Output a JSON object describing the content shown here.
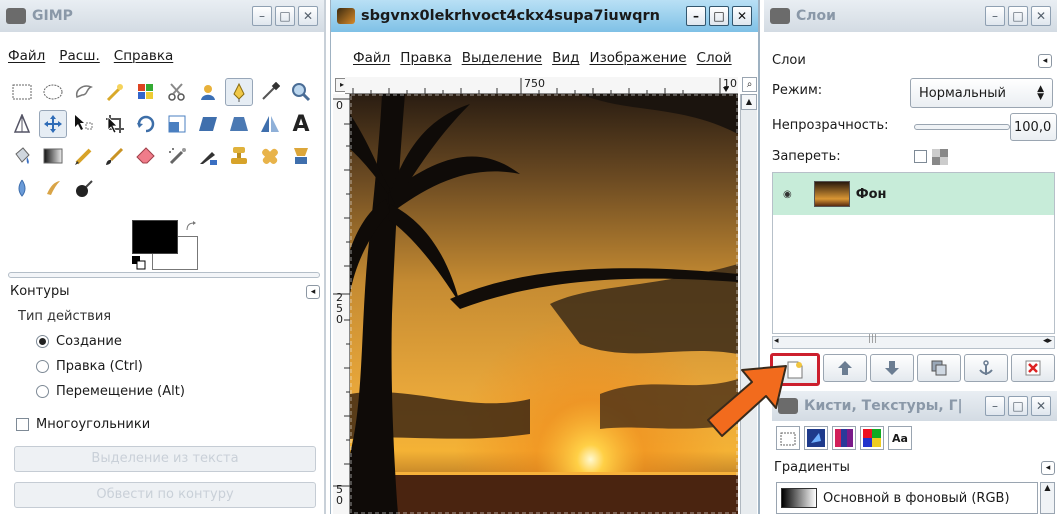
{
  "toolbox": {
    "title": "GIMP",
    "menu": [
      "Файл",
      "Расш.",
      "Справка"
    ],
    "tool_icons": [
      "rect-select-icon",
      "ellipse-select-icon",
      "free-select-icon",
      "fuzzy-select-icon",
      "color-select-icon",
      "scissors-icon",
      "foreground-select-icon",
      "paths-tool-icon",
      "color-picker-icon",
      "zoom-icon",
      "measure-icon",
      "move-icon",
      "align-icon",
      "crop-icon",
      "rotate-icon",
      "scale-icon",
      "shear-icon",
      "perspective-icon",
      "flip-icon",
      "text-icon",
      "bucket-fill-icon",
      "blend-icon",
      "pencil-icon",
      "paintbrush-icon",
      "eraser-icon",
      "airbrush-icon",
      "ink-icon",
      "clone-icon",
      "heal-icon",
      "perspective-clone-icon",
      "blur-icon",
      "smudge-icon",
      "dodge-burn-icon"
    ],
    "options_title": "Контуры",
    "mode_label": "Тип действия",
    "modes": [
      "Создание",
      "Правка (Ctrl)",
      "Перемещение (Alt)"
    ],
    "polygonal_label": "Многоугольники",
    "selection_from_path": "Выделение из текста",
    "stroke_path": "Обвести по контуру"
  },
  "image_window": {
    "title": "sbgvnx0lekrhvoct4ckx4supa7iuwqrn",
    "menu": [
      "Файл",
      "Правка",
      "Выделение",
      "Вид",
      "Изображение",
      "Слой"
    ],
    "ruler_h_labels": [
      "750",
      "10"
    ],
    "ruler_v_labels": [
      "0",
      "250",
      "50"
    ]
  },
  "layers_dialog": {
    "title": "Слои",
    "tab_label": "Слои",
    "mode_label": "Режим:",
    "mode_value": "Нормальный",
    "opacity_label": "Непрозрачность:",
    "opacity_value": "100,0",
    "lock_label": "Запереть:",
    "layer_name": "Фон"
  },
  "brushes_dialog": {
    "title": "Кисти, Текстуры, Г|",
    "section_label": "Градиенты",
    "gradient_name": "Основной в фоновый (RGB)"
  },
  "colors": {
    "accent_highlight": "#cc1f2d",
    "arrow": "#f26b1d",
    "layer_selected": "#c7ecd9"
  }
}
